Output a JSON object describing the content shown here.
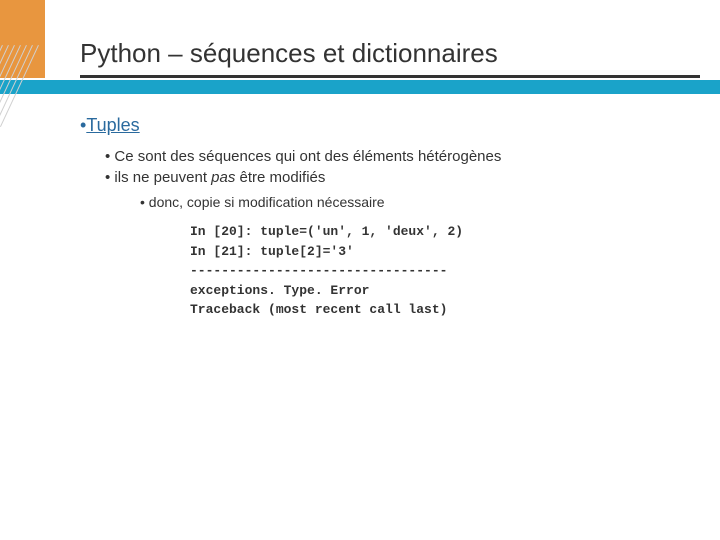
{
  "title": "Python – séquences et dictionnaires",
  "section": {
    "heading": "Tuples",
    "points": [
      "Ce sont des séquences qui ont des éléments hétérogènes",
      "ils ne peuvent "
    ],
    "pas": "pas",
    "points_tail": " être modifiés",
    "subpoint": "donc, copie si modification nécessaire"
  },
  "code": {
    "line1": "In [20]: tuple=('un', 1, 'deux', 2)",
    "line2": "In [21]: tuple[2]='3'",
    "line3": "---------------------------------",
    "line4": "exceptions. Type. Error",
    "line5": "Traceback (most recent call last)"
  }
}
